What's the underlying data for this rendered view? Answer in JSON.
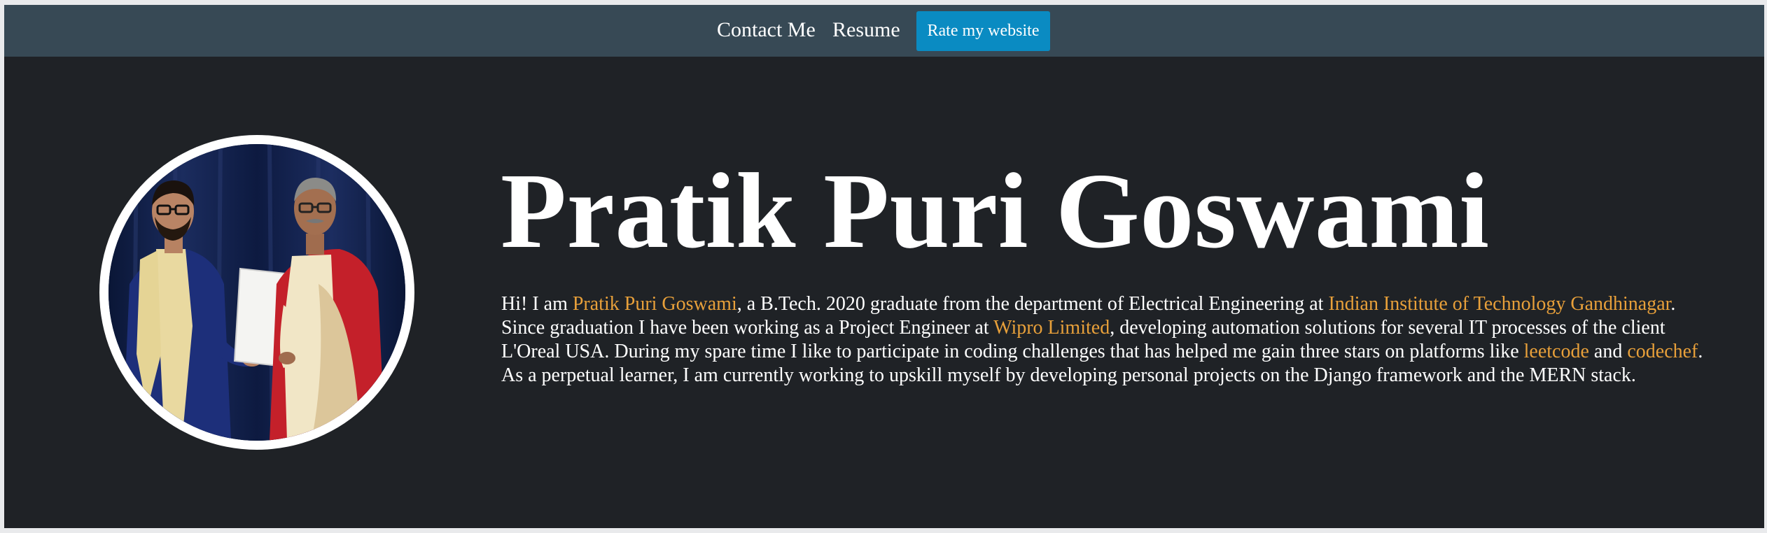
{
  "nav": {
    "contact_label": "Contact Me",
    "resume_label": "Resume",
    "rate_label": "Rate my website"
  },
  "hero": {
    "name": "Pratik Puri Goswami",
    "bio": {
      "t1": "Hi! I am ",
      "link_name": "Pratik Puri Goswami",
      "t2": ", a B.Tech. 2020 graduate from the department of Electrical Engineering at ",
      "link_iit": "Indian Institute of Technology Gandhinagar",
      "t3": ". Since graduation I have been working as a Project Engineer at ",
      "link_wipro": "Wipro Limited",
      "t4": ", developing automation solutions for several IT processes of the client L'Oreal USA. During my spare time I like to participate in coding challenges that has helped me gain three stars on platforms like ",
      "link_leetcode": "leetcode",
      "t5": " and ",
      "link_codechef": "codechef",
      "t6": ". As a perpetual learner, I am currently working to upskill myself by developing personal projects on the Django framework and the MERN stack."
    }
  },
  "colors": {
    "page_bg": "#1f2226",
    "navbar_bg": "#374955",
    "button_bg": "#0a8bc2",
    "link": "#e8a03a",
    "text": "#ffffff"
  }
}
